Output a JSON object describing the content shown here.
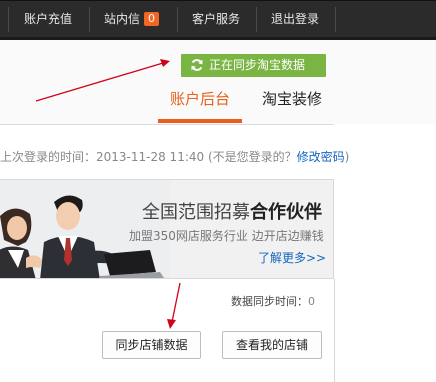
{
  "topbar": {
    "recharge": "账户充值",
    "messages": "站内信",
    "message_count": "0",
    "service": "客户服务",
    "logout": "退出登录"
  },
  "header": {
    "sync_button": "正在同步淘宝数据",
    "tab_account": "账户后台",
    "tab_decorate": "淘宝装修"
  },
  "last_login": {
    "prefix": "上次登录的时间：2013-11-28 11:40 (不是您登录的？",
    "link": "修改密码",
    "suffix": ")"
  },
  "banner": {
    "title_normal": "全国范围招募",
    "title_bold": "合作伙伴",
    "subtitle": "加盟350网店服务行业  边开店边赚钱",
    "more": "了解更多>>"
  },
  "panel": {
    "sync_time_label": "数据同步时间：",
    "sync_time_value": "0",
    "sync_store_button": "同步店铺数据",
    "view_store_button": "查看我的店铺"
  },
  "colors": {
    "topbar": "#2b2b2b",
    "accent_orange": "#e8601c",
    "sync_green": "#7ab543",
    "link_blue": "#1565c0",
    "annotation_red": "#d0021b"
  },
  "icons": {
    "sync": "refresh-icon"
  }
}
